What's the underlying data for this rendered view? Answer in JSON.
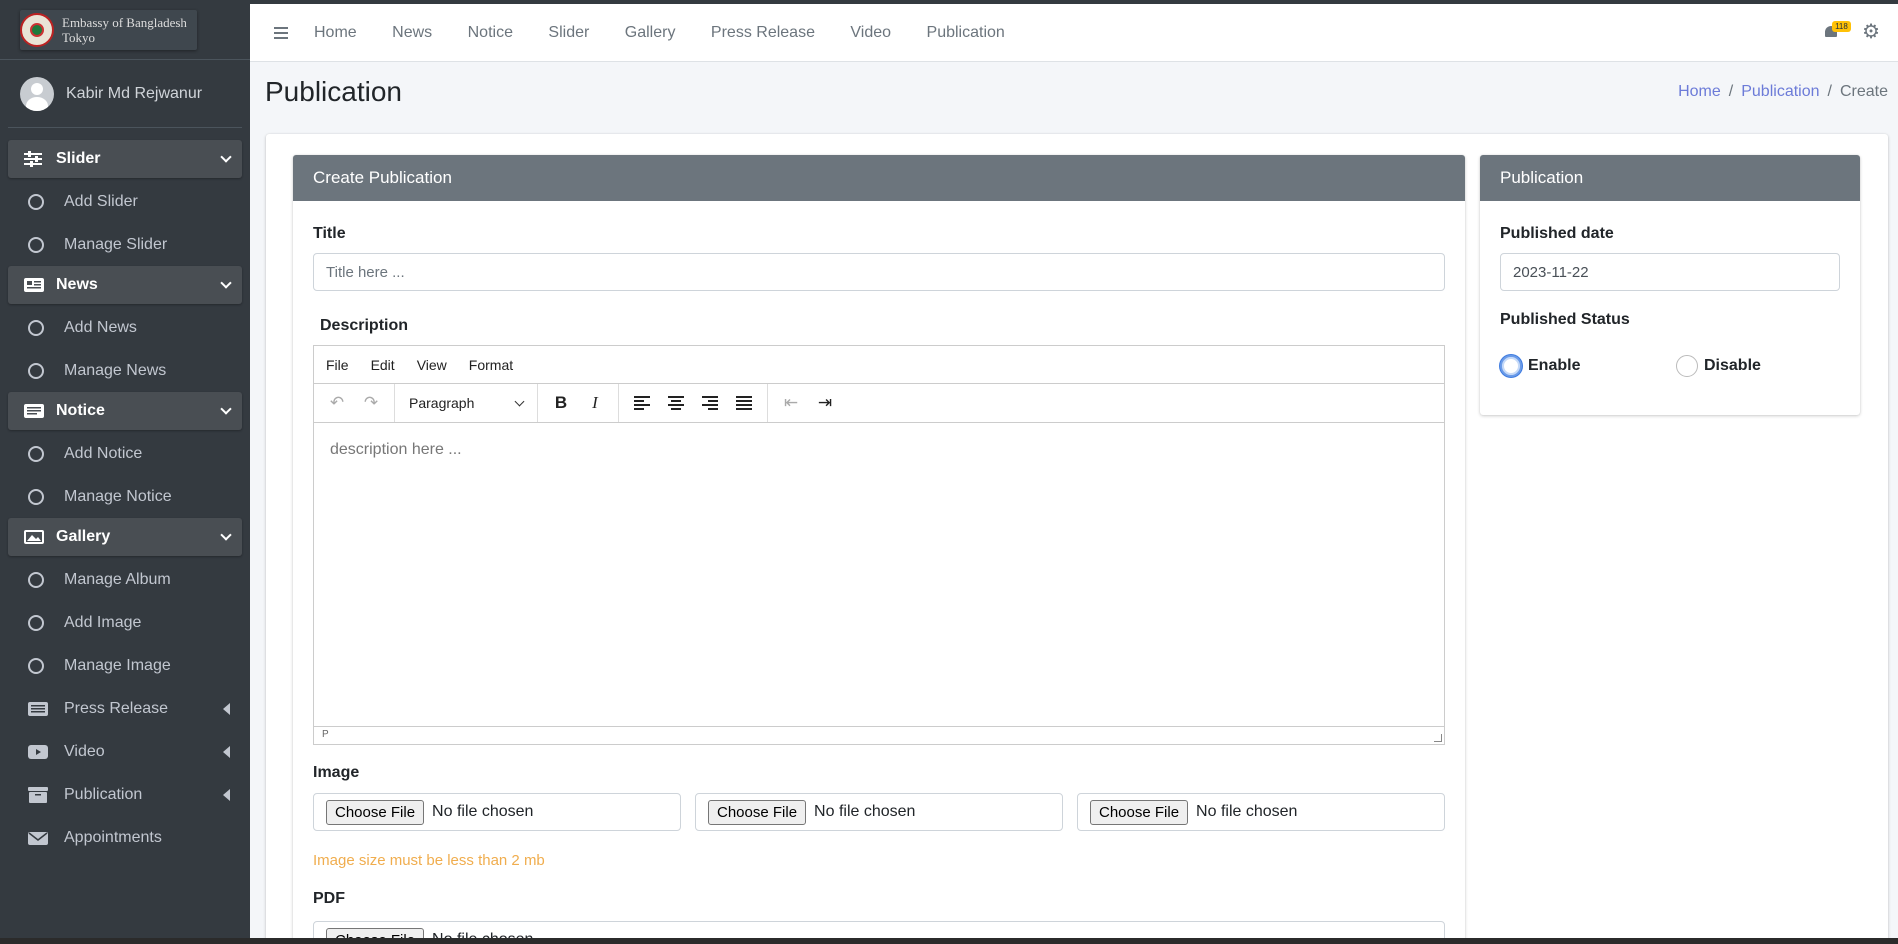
{
  "brand": {
    "line1": "Embassy of Bangladesh",
    "line2": "Tokyo"
  },
  "user": {
    "name": "Kabir Md Rejwanur"
  },
  "sidebar": {
    "slider": {
      "label": "Slider",
      "items": [
        "Add Slider",
        "Manage Slider"
      ]
    },
    "news": {
      "label": "News",
      "items": [
        "Add News",
        "Manage News"
      ]
    },
    "notice": {
      "label": "Notice",
      "items": [
        "Add Notice",
        "Manage Notice"
      ]
    },
    "gallery": {
      "label": "Gallery",
      "items": [
        "Manage Album",
        "Add Image",
        "Manage Image"
      ]
    },
    "press_release": "Press Release",
    "video": "Video",
    "publication": "Publication",
    "appointments": "Appointments"
  },
  "topnav": [
    "Home",
    "News",
    "Notice",
    "Slider",
    "Gallery",
    "Press Release",
    "Video",
    "Publication"
  ],
  "notifications": {
    "count": "118"
  },
  "page": {
    "title": "Publication"
  },
  "breadcrumb": [
    "Home",
    "Publication",
    "Create"
  ],
  "form": {
    "header": "Create Publication",
    "title_label": "Title",
    "title_placeholder": "Title here ...",
    "description_label": "Description",
    "editor_menu": [
      "File",
      "Edit",
      "View",
      "Format"
    ],
    "block_format": "Paragraph",
    "description_placeholder": "description here ...",
    "status_path": "P",
    "image_label": "Image",
    "choose_file": "Choose File",
    "no_file": "No file chosen",
    "image_hint": "Image size must be less than 2 mb",
    "pdf_label": "PDF"
  },
  "side": {
    "header": "Publication",
    "date_label": "Published date",
    "date_value": "2023-11-22",
    "status_label": "Published Status",
    "enable": "Enable",
    "disable": "Disable",
    "selected": "Enable"
  },
  "colors": {
    "sidebar": "#343a40",
    "card_header": "#6c757d",
    "link": "#6c7bd8",
    "hint": "#f0ad4e",
    "badge": "#ffc107"
  }
}
